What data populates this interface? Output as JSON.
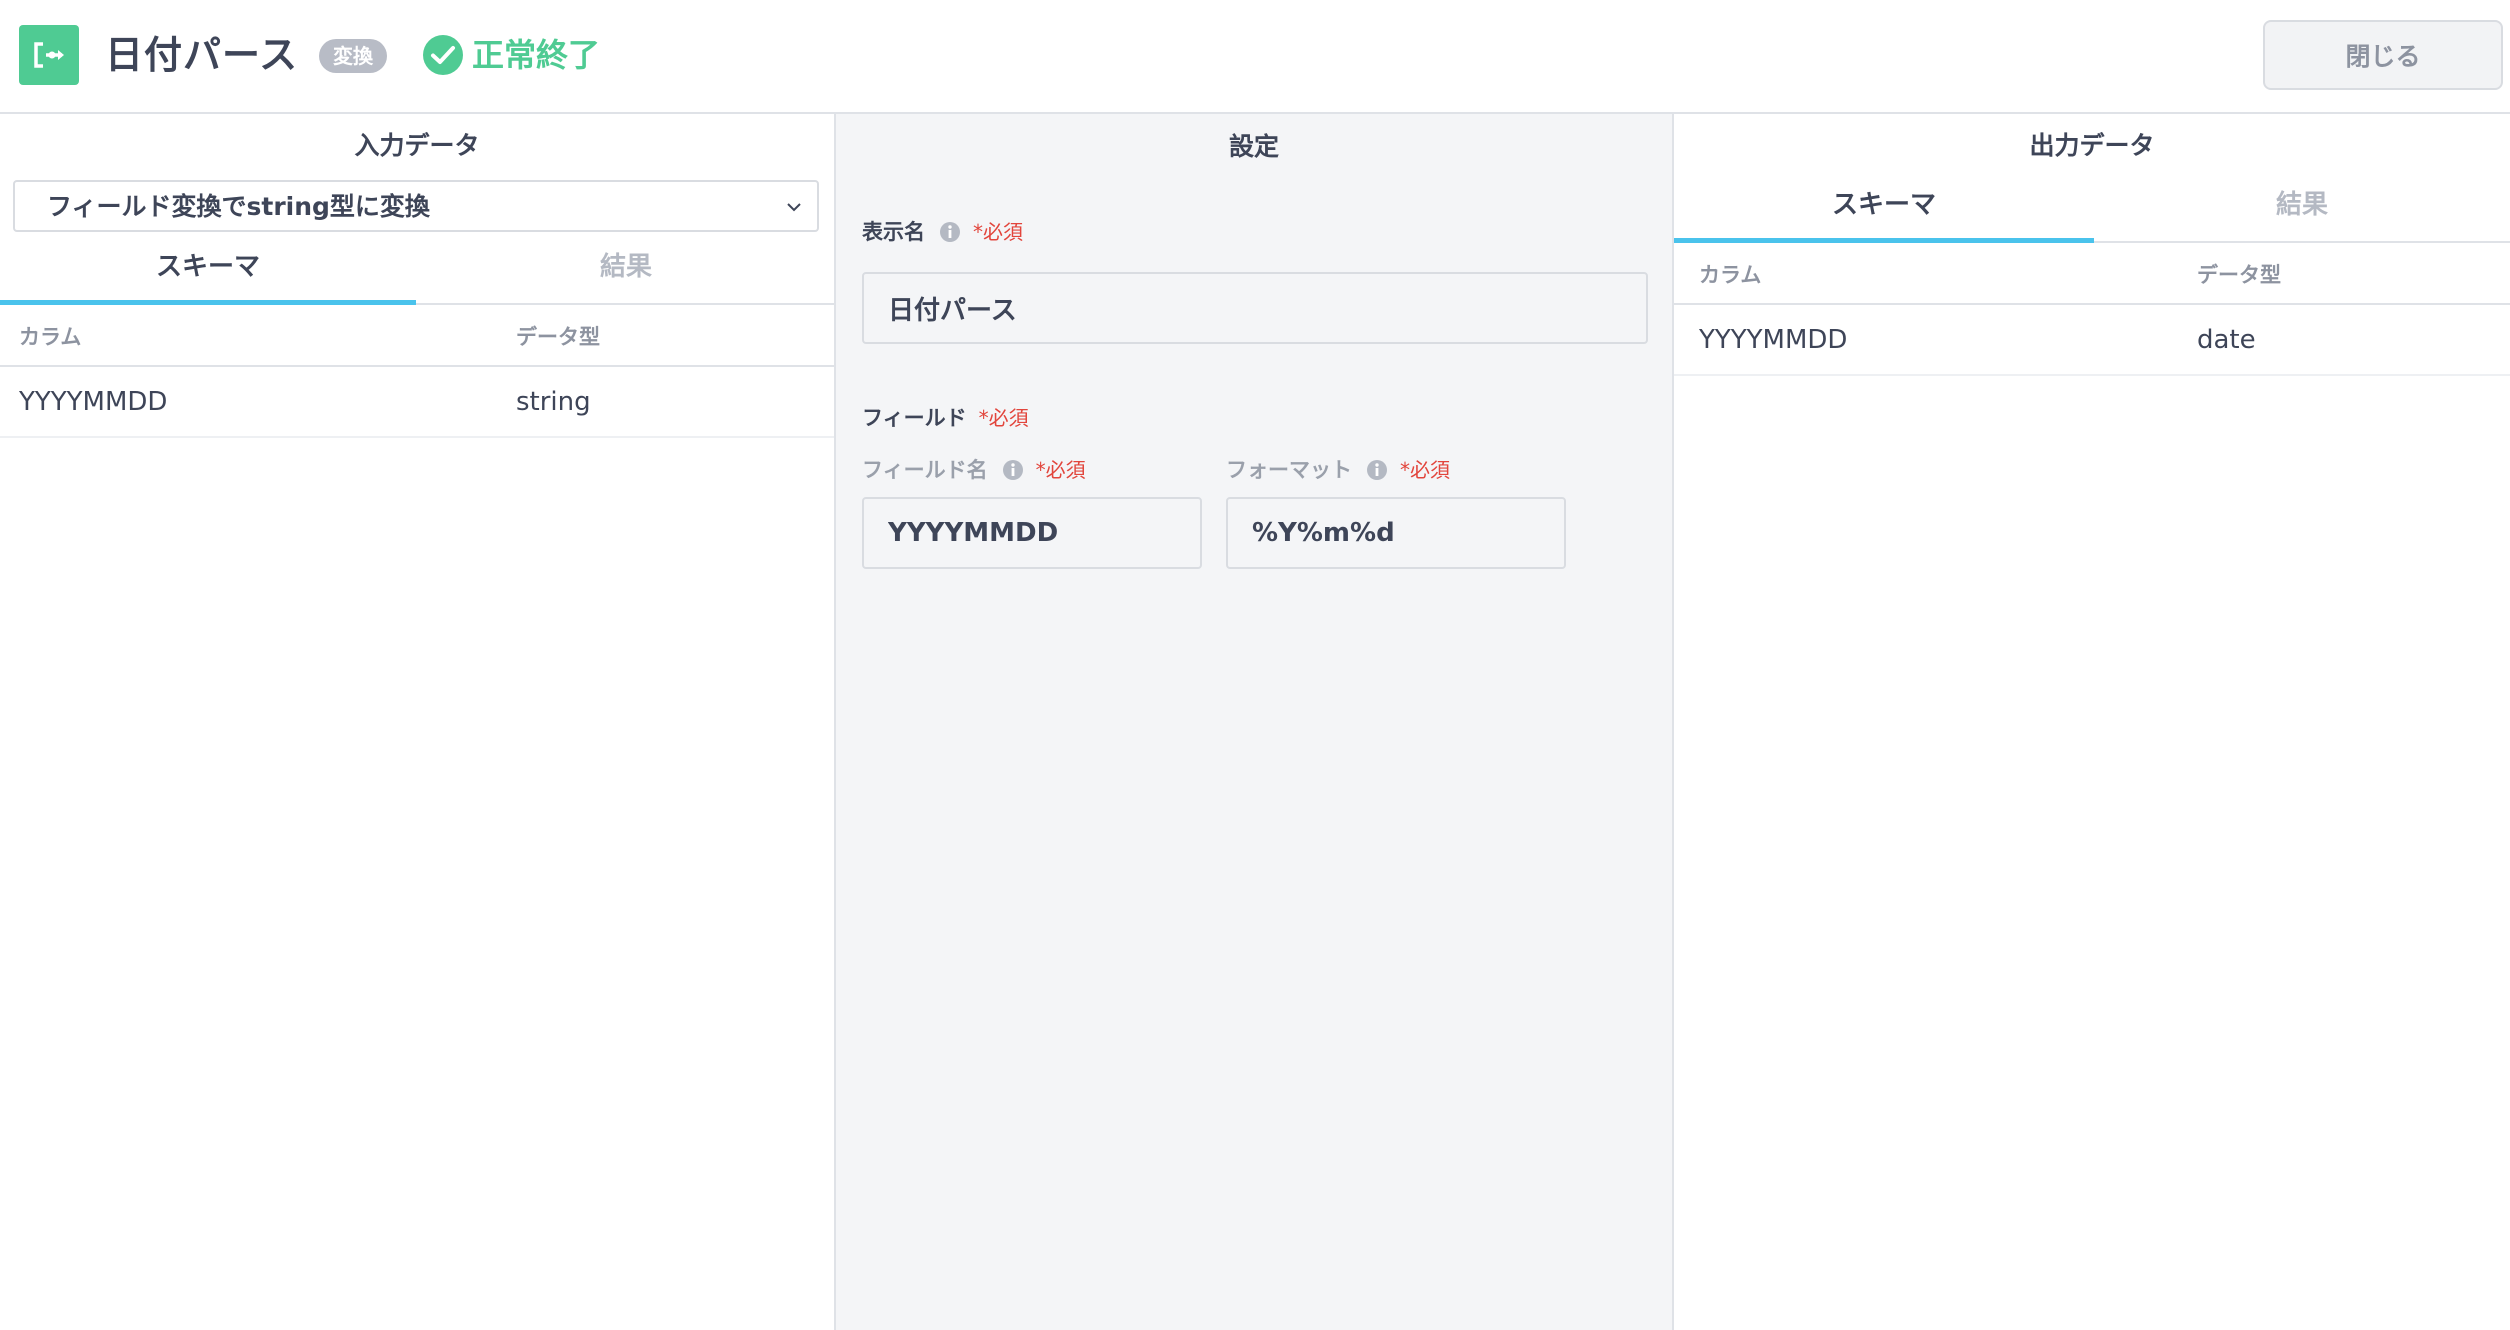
{
  "header": {
    "title": "日付パース",
    "type_badge": "変換",
    "status": "正常終了",
    "close_label": "閉じる"
  },
  "input_panel": {
    "title": "入力データ",
    "source_select": "フィールド変換でstring型に変換",
    "tabs": [
      "スキーマ",
      "結果"
    ],
    "active_tab": "スキーマ",
    "columns": [
      "カラム",
      "データ型"
    ],
    "rows": [
      {
        "column": "YYYYMMDD",
        "type": "string"
      }
    ]
  },
  "settings_panel": {
    "title": "設定",
    "display_name_label": "表示名",
    "required": "*必須",
    "display_name_value": "日付パース",
    "field_section_label": "フィールド",
    "field_name_label": "フィールド名",
    "field_name_value": "YYYYMMDD",
    "format_label": "フォーマット",
    "format_value": "%Y%m%d"
  },
  "output_panel": {
    "title": "出力データ",
    "tabs": [
      "スキーマ",
      "結果"
    ],
    "active_tab": "スキーマ",
    "columns": [
      "カラム",
      "データ型"
    ],
    "rows": [
      {
        "column": "YYYYMMDD",
        "type": "date"
      }
    ]
  },
  "colors": {
    "accent_green": "#4fcb93",
    "tab_underline": "#4ac3ec",
    "required_red": "#e2453c"
  },
  "icons": {
    "app": "split-flow-icon",
    "status": "check-circle-icon",
    "select": "chevron-down-icon",
    "help": "info-icon"
  }
}
